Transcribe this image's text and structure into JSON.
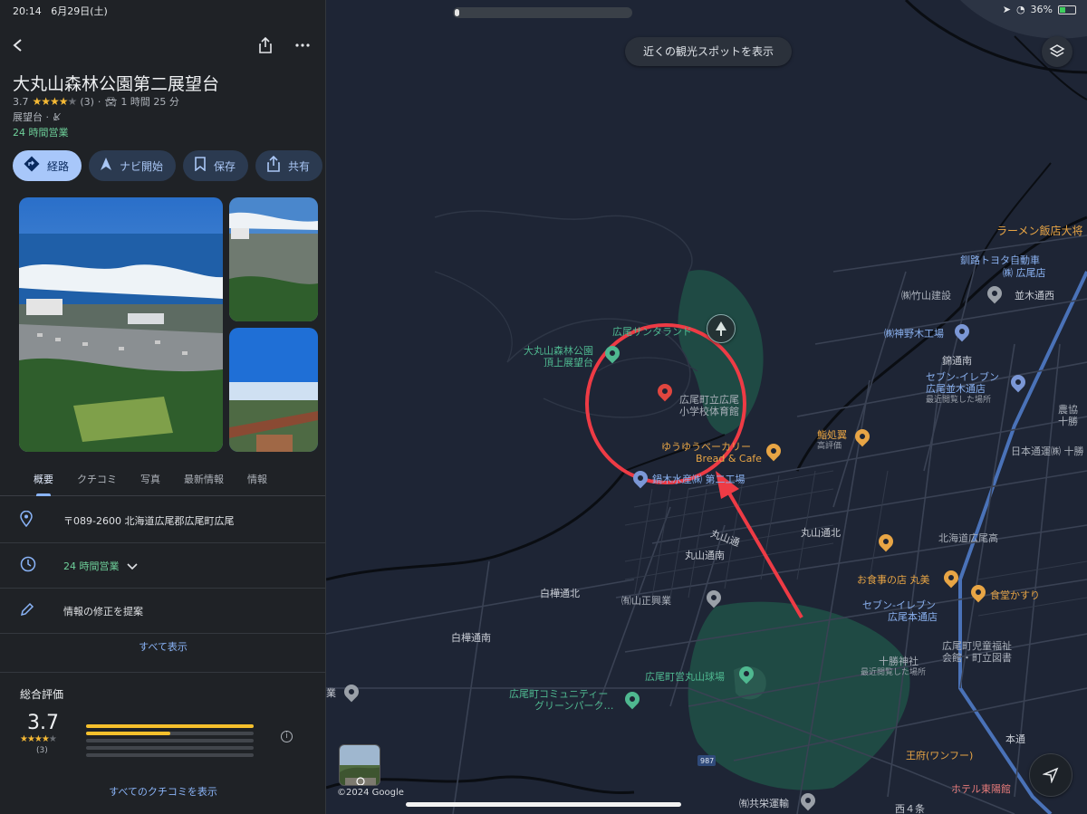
{
  "status_bar": {
    "time": "20:14",
    "date": "6月29日(土)",
    "battery": "36%"
  },
  "place": {
    "title": "大丸山森林公園第二展望台",
    "rating": "3.7",
    "review_count": "(3)",
    "travel_time": "1 時間 25 分",
    "category": "展望台 ·",
    "open_status": "24 時間営業"
  },
  "actions": [
    {
      "label": "経路",
      "icon": "directions-icon"
    },
    {
      "label": "ナビ開始",
      "icon": "navigation-arrow-icon"
    },
    {
      "label": "保存",
      "icon": "bookmark-icon"
    },
    {
      "label": "共有",
      "icon": "share-icon"
    }
  ],
  "tabs": [
    "概要",
    "クチコミ",
    "写真",
    "最新情報",
    "情報"
  ],
  "info": {
    "address": "〒089-2600 北海道広尾郡広尾町広尾",
    "hours": "24 時間営業",
    "suggest_edit": "情報の修正を提案",
    "show_all": "すべて表示"
  },
  "reviews": {
    "title": "総合評価",
    "score": "3.7",
    "count": "(3)",
    "distribution": [
      1.0,
      0.5,
      0,
      0,
      0
    ],
    "all_reviews": "すべてのクチコミを表示"
  },
  "map": {
    "nearby_button": "近くの観光スポットを表示",
    "copyright": "©2024 Google",
    "road_badge": "987",
    "labels": {
      "ramen": "ラーメン飯店大将",
      "toyota1": "釧路トヨタ自動車",
      "toyota2": "㈱ 広尾店",
      "takeyama": "㈱竹山建設",
      "namiki": "並木通西",
      "kamino": "㈱神野木工場",
      "nishikido": "錦通南",
      "seven1_a": "セブン-イレブン",
      "seven1_b": "広尾並木通店",
      "seven1_sub": "最近閲覧した場所",
      "nokyo_a": "農協",
      "nokyo_b": "十勝",
      "nippon": "日本通運㈱ 十勝",
      "lookout1_a": "大丸山森林公園",
      "lookout1_b": "頂上展望台",
      "suntarant": "広尾サンタランド",
      "school_a": "広尾町立広尾",
      "school_b": "小学校体育館",
      "yuyu_a": "ゆうゆうベーカリー",
      "yuyu_b": "Bread & Cafe",
      "ayu_a": "鮨処翼",
      "ayu_b": "高評価",
      "suisan": "鍋木水産㈱ 第二工場",
      "maruyama_kita": "丸山通北",
      "maruyama_road": "丸山通",
      "maruyama_minami": "丸山通南",
      "hokkaido_ko": "北海道広尾高",
      "shirakaba_kita": "白樺通北",
      "yamasho": "㈲山正興業",
      "omiyoshi": "お食事の店 丸美",
      "shokudo": "食堂かすり",
      "seven2_a": "セブン-イレブン",
      "seven2_b": "広尾本通店",
      "shirakaba_minami": "白樺通南",
      "jido_a": "広尾町児童福祉",
      "jido_b": "会館・町立図書",
      "tokachi_shrine": "十勝神社",
      "tokachi_sub": "最近閲覧した場所",
      "baseball": "広尾町営丸山球場",
      "community_a": "広尾町コミュニティー",
      "community_b": "グリーンパーク…",
      "honcho": "本通",
      "wanfu": "王府(ワンフー)",
      "hotel": "ホテル東陽館",
      "kyoei": "㈲共栄運輸",
      "nishi4": "西４条",
      "left_cut": "業"
    }
  },
  "colors": {
    "accent_blue": "#8ab4f8",
    "primary_button": "#a8c7fa",
    "open_green": "#6ed09a",
    "star_yellow": "#f5b935",
    "annotation_red": "#ee3b45",
    "park_green": "#1f4a44"
  }
}
